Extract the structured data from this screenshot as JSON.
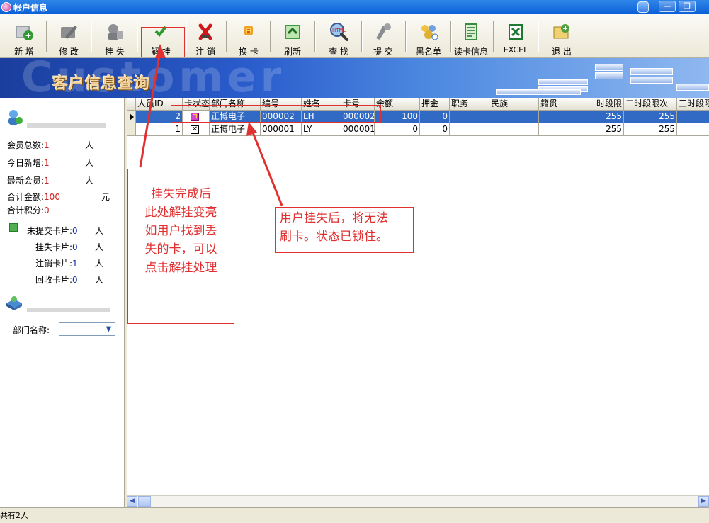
{
  "window": {
    "title": "帐户信息",
    "minimize_label": "—",
    "restore_label": "❐"
  },
  "toolbar": {
    "buttons": [
      {
        "label": "新 增",
        "icon": "add-member-icon"
      },
      {
        "label": "修 改",
        "icon": "edit-icon"
      },
      {
        "label": "挂 失",
        "icon": "report-loss-icon"
      },
      {
        "label": "解 挂",
        "icon": "check-icon"
      },
      {
        "label": "注 销",
        "icon": "cancel-x-icon"
      },
      {
        "label": "换 卡",
        "icon": "change-card-icon"
      },
      {
        "label": "刷新",
        "icon": "refresh-icon"
      },
      {
        "label": "查 找",
        "icon": "search-html-icon"
      },
      {
        "label": "提 交",
        "icon": "submit-icon"
      },
      {
        "label": "黑名单",
        "icon": "blacklist-icon"
      },
      {
        "label": "读卡信息",
        "icon": "read-card-icon"
      },
      {
        "label": "EXCEL",
        "icon": "excel-icon"
      },
      {
        "label": "退 出",
        "icon": "exit-icon"
      }
    ]
  },
  "banner": {
    "background_word": "Customer",
    "title": "客户信息查询"
  },
  "left_panel": {
    "stats": [
      {
        "label": "会员总数:",
        "value": "1",
        "unit": "人"
      },
      {
        "label": "今日新增:",
        "value": "1",
        "unit": "人"
      },
      {
        "label": "最新会员:",
        "value": "1",
        "unit": "人"
      },
      {
        "label": "合计金额:",
        "value": "100",
        "unit": "元"
      },
      {
        "label": "合计积分:",
        "value": "0",
        "unit": ""
      }
    ],
    "card_stats": [
      {
        "label": "未提交卡片:",
        "value": "0",
        "unit": "人"
      },
      {
        "label": "挂失卡片:",
        "value": "0",
        "unit": "人"
      },
      {
        "label": "注销卡片:",
        "value": "1",
        "unit": "人"
      },
      {
        "label": "回收卡片:",
        "value": "0",
        "unit": "人"
      }
    ],
    "department_label": "部门名称:",
    "department_value": ""
  },
  "grid": {
    "columns": [
      "人员ID",
      "卡状态",
      "部门名称",
      "编号",
      "姓名",
      "卡号",
      "余额",
      "押金",
      "职务",
      "民族",
      "籍贯",
      "一时段限",
      "二时段限次",
      "三时段限"
    ],
    "rows": [
      {
        "id": "2",
        "status_icon": "lock-icon",
        "dept": "正博电子",
        "code": "000002",
        "name": "LH",
        "card": "000002",
        "balance": "100",
        "deposit": "0",
        "t1": "255",
        "t2": "255",
        "selected": true
      },
      {
        "id": "1",
        "status_icon": "cancelled-card-icon",
        "dept": "正博电子",
        "code": "000001",
        "name": "LY",
        "card": "000001",
        "balance": "0",
        "deposit": "0",
        "t1": "255",
        "t2": "255",
        "selected": false
      }
    ]
  },
  "status_bar": {
    "text": "共有2人"
  },
  "annotations": {
    "note_left": [
      "挂失完成后",
      "此处解挂变亮",
      "如用户找到丢",
      "失的卡，可以",
      "点击解挂处理"
    ],
    "note_right": [
      "用户挂失后，将无法",
      "刷卡。状态已锁住。"
    ],
    "color": "#e03030"
  },
  "colors": {
    "selection": "#316ac5",
    "titlebar": "#0b5fd7",
    "value_red": "#d02020"
  }
}
